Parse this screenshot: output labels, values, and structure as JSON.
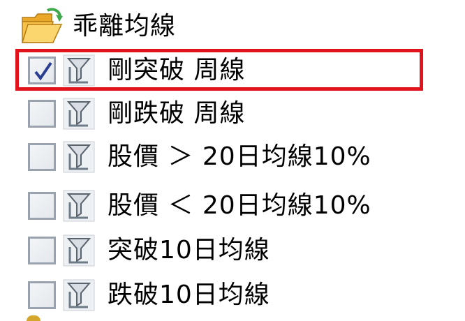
{
  "colors": {
    "highlight_border": "#e1141d",
    "checkbox_border": "#9aa3ad",
    "check_mark": "#2a3f93",
    "folder": "#f2b93b",
    "folder_arrow": "#3fa84b",
    "numeral_text": "#1a2a7a"
  },
  "tree": {
    "folder": {
      "icon": "folder-open-icon",
      "label": "乖離均線"
    },
    "items": [
      {
        "checked": true,
        "icon": "filter-icon",
        "label": "剛突破 周線"
      },
      {
        "checked": false,
        "icon": "filter-icon",
        "label": "剛跌破 周線"
      },
      {
        "checked": false,
        "icon": "filter-icon",
        "label": "股價 ＞ 20日均線10%"
      },
      {
        "checked": false,
        "icon": "filter-icon",
        "label": "股價 ＜ 20日均線10%"
      },
      {
        "checked": false,
        "icon": "filter-icon",
        "label": "突破10日均線"
      },
      {
        "checked": false,
        "icon": "filter-icon",
        "label": "跌破10日均線"
      }
    ],
    "highlighted_item": "剛突破 周線"
  }
}
